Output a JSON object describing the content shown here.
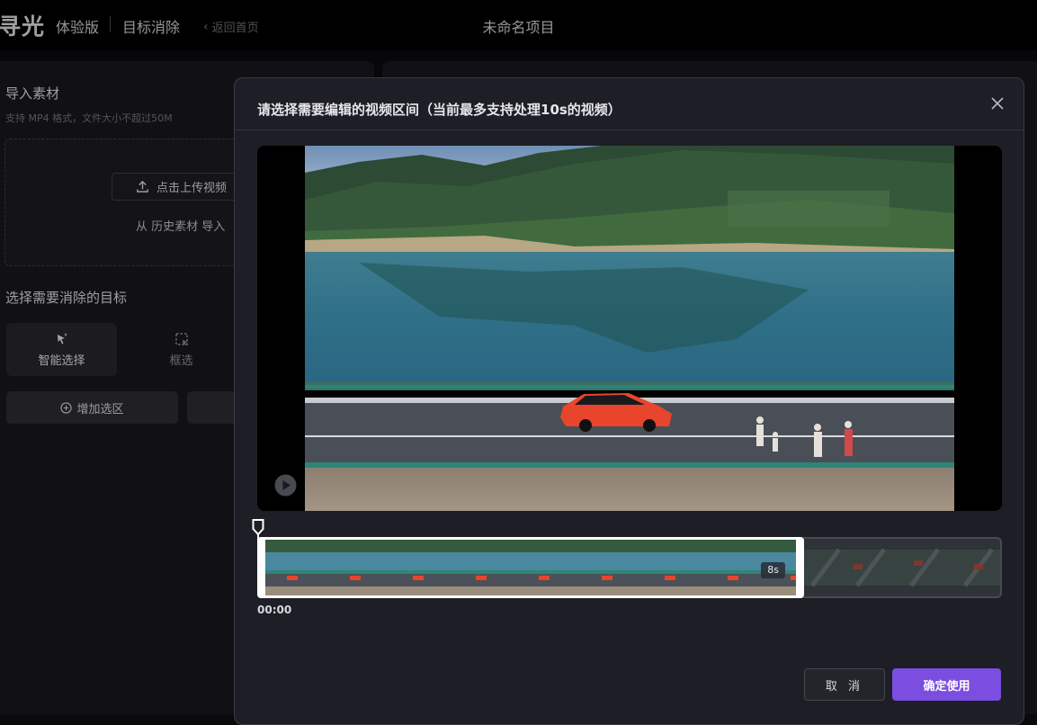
{
  "topbar": {
    "logo": "寻光",
    "edition": "体验版",
    "tool_name": "目标消除",
    "back_label": "返回首页",
    "project_title": "未命名项目"
  },
  "left": {
    "import_title": "导入素材",
    "import_desc": "支持 MP4 格式，文件大小不超过50M",
    "upload_label": "点击上传视频",
    "history_label": "从 历史素材 导入",
    "target_title": "选择需要消除的目标",
    "tools": [
      {
        "label": "智能选择",
        "icon": "magic-cursor-icon"
      },
      {
        "label": "框选",
        "icon": "box-select-icon"
      }
    ],
    "add_label": "增加选区"
  },
  "modal": {
    "title": "请选择需要编辑的视频区间（当前最多支持处理10s的视频）",
    "duration_badge": "8s",
    "start_time": "00:00",
    "cancel_label": "取 消",
    "confirm_label": "确定使用",
    "accent_color": "#7b4de0"
  }
}
